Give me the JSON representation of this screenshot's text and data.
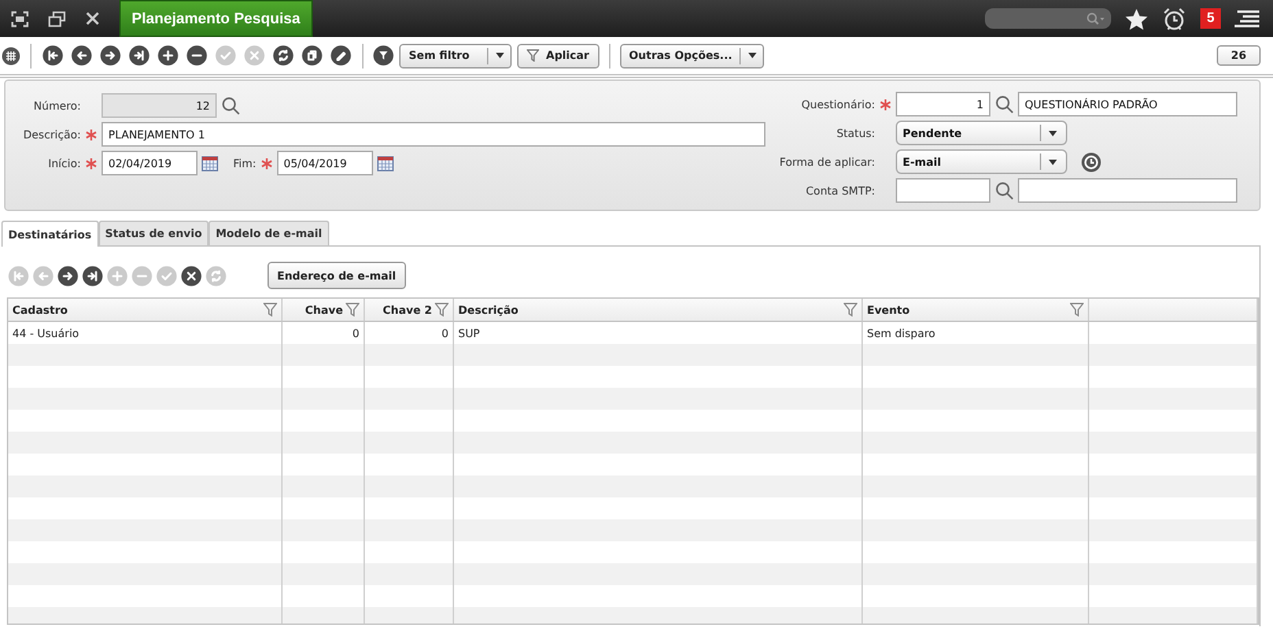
{
  "top_bar": {
    "app_tab": {
      "label": "Planejamento Pesquisa",
      "selected": true
    },
    "notification_count": "5"
  },
  "toolbar": {
    "nav_buttons": [
      {
        "kind": "first",
        "disabled": false
      },
      {
        "kind": "prev",
        "disabled": false
      },
      {
        "kind": "next",
        "disabled": false
      },
      {
        "kind": "last",
        "disabled": false
      },
      {
        "kind": "add",
        "disabled": false
      },
      {
        "kind": "remove",
        "disabled": false
      },
      {
        "kind": "confirm",
        "disabled": true
      },
      {
        "kind": "cancel",
        "disabled": true
      },
      {
        "kind": "refresh",
        "disabled": false
      },
      {
        "kind": "copy",
        "disabled": false
      },
      {
        "kind": "edit",
        "disabled": false
      }
    ],
    "filter": "Sem filtro",
    "apply_button": "Aplicar",
    "options_menu": "Outras Opções...",
    "record_count": "26"
  },
  "form": {
    "left_rows": [
      [
        {
          "kind": "code",
          "label": "Número:",
          "required": false,
          "readonly": true,
          "value": "12"
        }
      ],
      [
        {
          "kind": "text",
          "label": "Descrição:",
          "required": true,
          "readonly": false,
          "value": "PLANEJAMENTO 1"
        }
      ],
      [
        {
          "kind": "date",
          "label": "Início:",
          "required": true,
          "readonly": false,
          "value": "02/04/2019"
        },
        {
          "kind": "date",
          "label": "Fim:",
          "required": true,
          "readonly": false,
          "value": "05/04/2019"
        }
      ]
    ],
    "right_rows": [
      [
        {
          "kind": "lookup",
          "label": "Questionário:",
          "required": true,
          "readonly": false,
          "code": "1",
          "name": "QUESTIONÁRIO PADRÃO"
        }
      ],
      [
        {
          "kind": "select",
          "label": "Status:",
          "required": false,
          "readonly": false,
          "value": "Pendente"
        }
      ],
      [
        {
          "kind": "select-clock",
          "label": "Forma de aplicar:",
          "required": false,
          "readonly": false,
          "value": "E-mail"
        }
      ],
      [
        {
          "kind": "lookup",
          "label": "Conta SMTP:",
          "required": false,
          "readonly": false
        }
      ]
    ]
  },
  "tabs": [
    {
      "label": "Destinatários",
      "selected": true
    },
    {
      "label": "Status de envio",
      "selected": false
    },
    {
      "label": "Modelo de e-mail",
      "selected": false
    }
  ],
  "record_toolbar": {
    "nav_buttons": [
      {
        "kind": "first",
        "disabled": true
      },
      {
        "kind": "prev",
        "disabled": true
      },
      {
        "kind": "next",
        "disabled": false
      },
      {
        "kind": "last",
        "disabled": false
      },
      {
        "kind": "add",
        "disabled": true
      },
      {
        "kind": "remove",
        "disabled": true
      },
      {
        "kind": "confirm",
        "disabled": true
      },
      {
        "kind": "cancel",
        "disabled": false
      },
      {
        "kind": "refresh",
        "disabled": true
      }
    ],
    "email_button": "Endereço de e-mail"
  },
  "table": {
    "columns": [
      {
        "label": "Cadastro",
        "kind": "text"
      },
      {
        "label": "Chave",
        "kind": "number"
      },
      {
        "label": "Chave 2",
        "kind": "number"
      },
      {
        "label": "Descrição",
        "kind": "text"
      },
      {
        "label": "Evento",
        "kind": "text"
      }
    ],
    "rows": [
      {
        "cells": [
          "44 - Usuário",
          "0",
          "0",
          "SUP",
          "Sem disparo"
        ]
      }
    ]
  }
}
